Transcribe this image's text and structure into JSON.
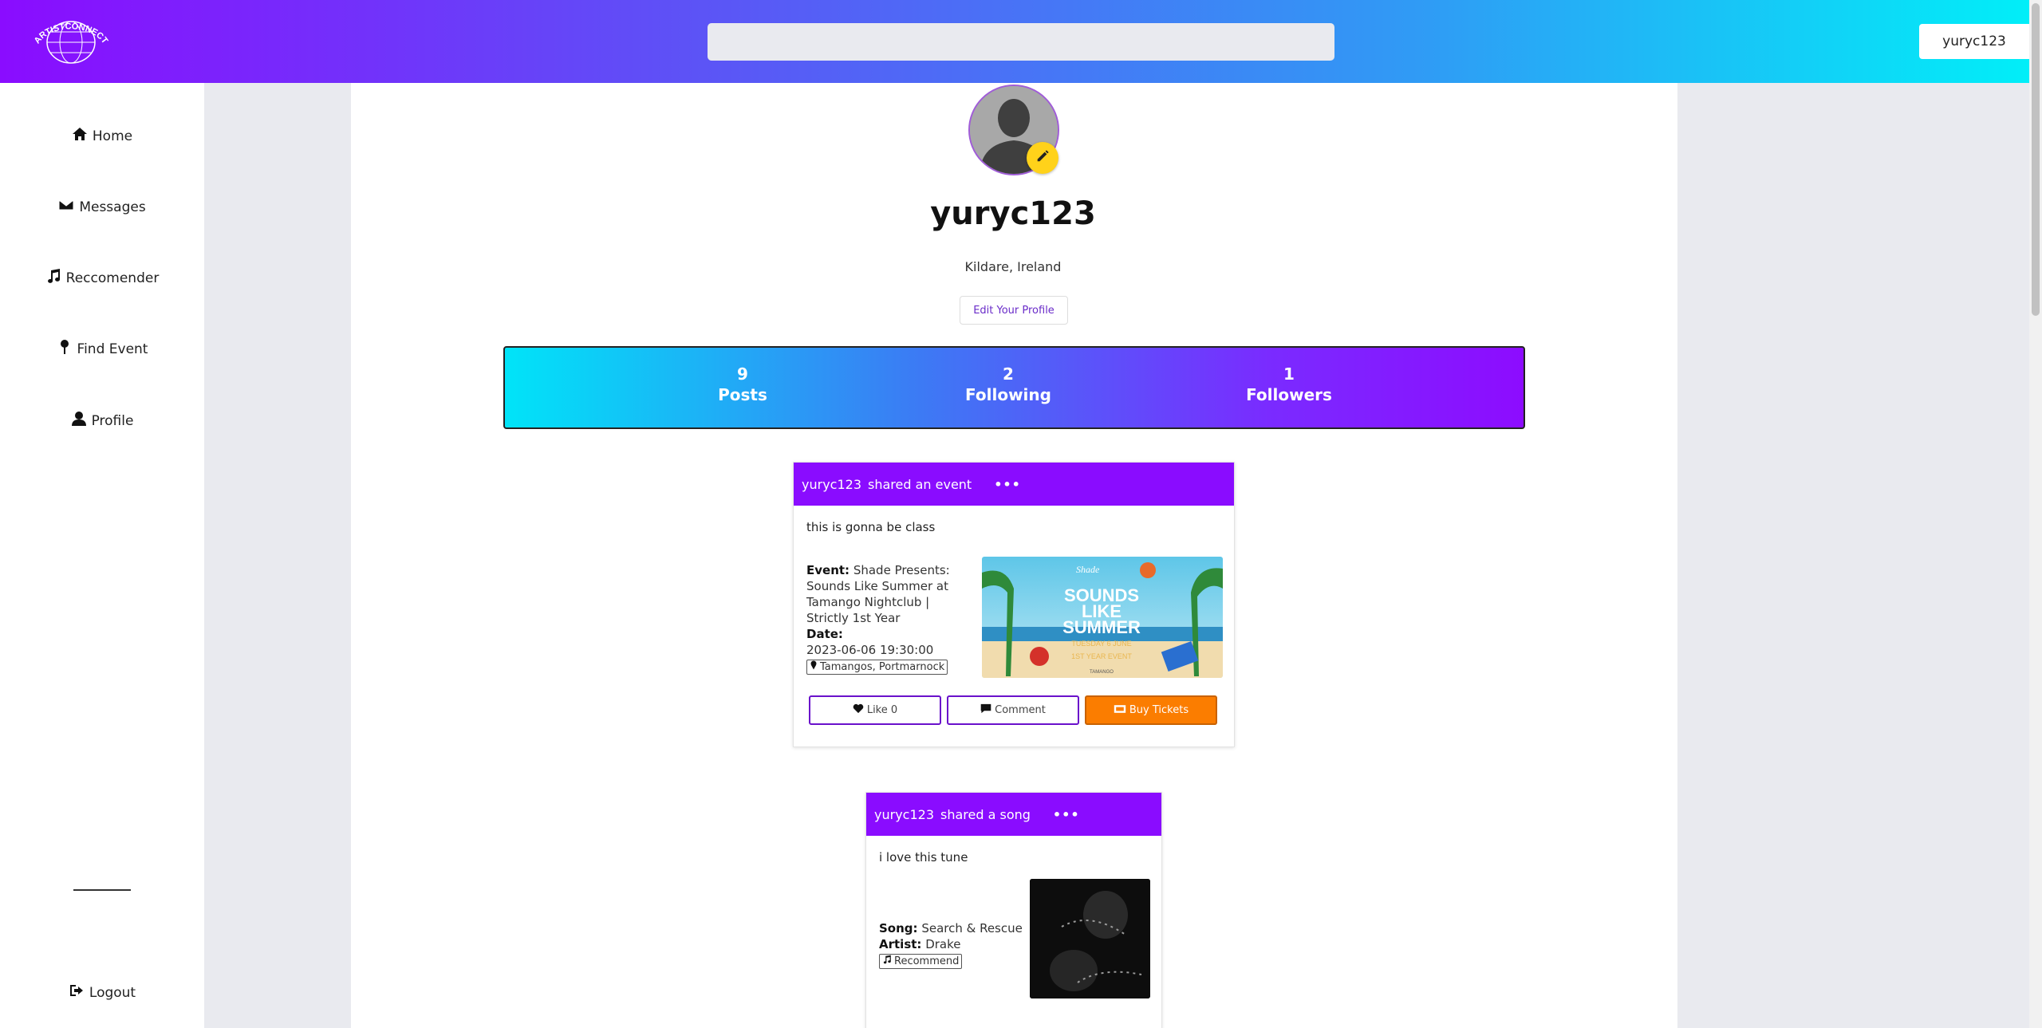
{
  "header": {
    "logo_text": "ARTISTCONNECT",
    "search_placeholder": "",
    "user_label": "yuryc123"
  },
  "sidebar": {
    "items": [
      {
        "label": "Home",
        "icon": "home-icon"
      },
      {
        "label": "Messages",
        "icon": "envelope-icon"
      },
      {
        "label": "Reccomender",
        "icon": "music-note-icon"
      },
      {
        "label": "Find Event",
        "icon": "map-pin-icon"
      },
      {
        "label": "Profile",
        "icon": "user-icon"
      }
    ],
    "logout_label": "Logout"
  },
  "profile": {
    "username": "yuryc123",
    "location": "Kildare, Ireland",
    "edit_label": "Edit Your Profile",
    "stats": [
      {
        "value": "9",
        "label": "Posts"
      },
      {
        "value": "2",
        "label": "Following"
      },
      {
        "value": "1",
        "label": "Followers"
      }
    ]
  },
  "posts": [
    {
      "user": "yuryc123",
      "action": "shared an event",
      "more": "•••",
      "caption": "this is gonna be class",
      "event_label": "Event:",
      "event_name": "Shade Presents: Sounds Like Summer at Tamango Nightclub | Strictly 1st Year",
      "date_label": "Date:",
      "date": "2023-06-06 19:30:00",
      "location": "Tamangos, Portmarnock",
      "image_text": {
        "brand": "Shade",
        "line1": "SOUNDS",
        "line2": "LIKE",
        "line3": "SUMMER",
        "sub": "TUESDAY 6 JUNE",
        "sub2": "1ST YEAR EVENT",
        "venue": "TAMANGO"
      },
      "like_label": "Like 0",
      "comment_label": "Comment",
      "buy_label": "Buy Tickets"
    },
    {
      "user": "yuryc123",
      "action": "shared a song",
      "more": "•••",
      "caption": "i love this tune",
      "song_label": "Song:",
      "song": "Search & Rescue",
      "artist_label": "Artist:",
      "artist": "Drake",
      "recommend_label": "Recommend"
    }
  ],
  "colors": {
    "accent_purple": "#8a0cff",
    "header_gradient_end": "#00f0f8",
    "buy_orange": "#fb7d00",
    "pen_yellow": "#ffd21a"
  }
}
